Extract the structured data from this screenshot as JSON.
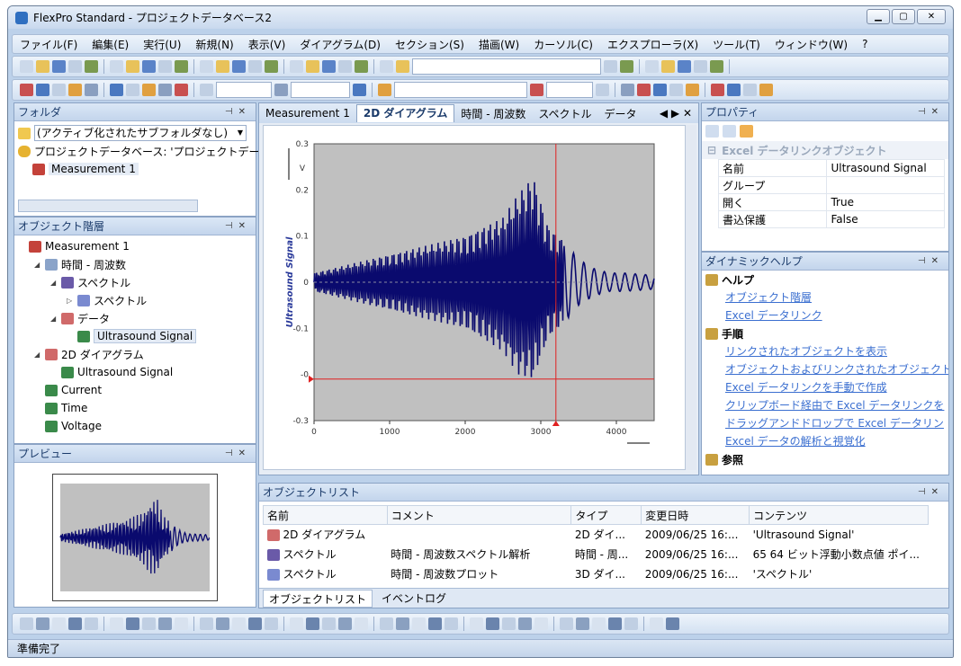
{
  "window": {
    "title": "FlexPro Standard - プロジェクトデータベース2"
  },
  "menu": [
    "ファイル(F)",
    "編集(E)",
    "実行(U)",
    "新規(N)",
    "表示(V)",
    "ダイアグラム(D)",
    "セクション(S)",
    "描画(W)",
    "カーソル(C)",
    "エクスプローラ(X)",
    "ツール(T)",
    "ウィンドウ(W)",
    "?"
  ],
  "folder": {
    "title": "フォルダ",
    "dropdown": "(アクティブ化されたサブフォルダなし)",
    "db": "プロジェクトデータベース: 'プロジェクトデー",
    "item": "Measurement 1"
  },
  "hierarchy": {
    "title": "オブジェクト階層",
    "items": [
      {
        "label": "Measurement 1",
        "indent": 0,
        "icon": "folder-icon"
      },
      {
        "label": "時間 - 周波数",
        "indent": 1,
        "icon": "document-icon",
        "tog": "◢"
      },
      {
        "label": "スペクトル",
        "indent": 2,
        "icon": "spectrum-icon",
        "tog": "◢"
      },
      {
        "label": "スペクトル",
        "indent": 3,
        "icon": "waterfall-icon",
        "tog": "▷"
      },
      {
        "label": "データ",
        "indent": 2,
        "icon": "diagram-icon",
        "tog": "◢"
      },
      {
        "label": "Ultrasound Signal",
        "indent": 3,
        "icon": "excel-link-icon",
        "sel": true
      },
      {
        "label": "2D ダイアグラム",
        "indent": 1,
        "icon": "diagram-icon",
        "tog": "◢"
      },
      {
        "label": "Ultrasound Signal",
        "indent": 2,
        "icon": "excel-link-icon"
      },
      {
        "label": "Current",
        "indent": 1,
        "icon": "excel-link-icon"
      },
      {
        "label": "Time",
        "indent": 1,
        "icon": "excel-link-icon"
      },
      {
        "label": "Voltage",
        "indent": 1,
        "icon": "excel-link-icon"
      }
    ]
  },
  "preview": {
    "title": "プレビュー"
  },
  "tabs": [
    "Measurement 1",
    "2D ダイアグラム",
    "時間 - 周波数",
    "スペクトル",
    "データ"
  ],
  "chart_data": {
    "type": "line",
    "ylabel": "Ultrasound Signal",
    "yunit": "V",
    "xlim": [
      0,
      4500
    ],
    "ylim": [
      -0.3,
      0.3
    ],
    "xticks": [
      "0",
      "1000",
      "2000",
      "3000",
      "4000"
    ],
    "yticks": [
      "0.3",
      "0.2",
      "0.1",
      "0",
      "-0.1",
      "-0",
      "-0.3"
    ],
    "envelope": {
      "x": [
        0,
        500,
        1000,
        1500,
        2000,
        2500,
        2700,
        2900,
        3100,
        3300,
        3500,
        3700,
        3900,
        4100,
        4500
      ],
      "upper": [
        0.02,
        0.04,
        0.06,
        0.08,
        0.1,
        0.14,
        0.19,
        0.23,
        0.12,
        0.09,
        0.05,
        0.03,
        0.02,
        0.02,
        0.015
      ],
      "lower": [
        -0.02,
        -0.04,
        -0.06,
        -0.08,
        -0.1,
        -0.15,
        -0.2,
        -0.21,
        -0.12,
        -0.09,
        -0.05,
        -0.03,
        -0.02,
        -0.02,
        -0.015
      ]
    },
    "cursor_x": 3200,
    "cursor_y": -0.21,
    "color": "#0a0a6e"
  },
  "props": {
    "title": "プロパティ",
    "section": "Excel データリンクオブジェクト",
    "rows": [
      [
        "名前",
        "Ultrasound Signal"
      ],
      [
        "グループ",
        ""
      ],
      [
        "開く",
        "True"
      ],
      [
        "書込保護",
        "False"
      ]
    ]
  },
  "help": {
    "title": "ダイナミックヘルプ",
    "h1": "ヘルプ",
    "links1": [
      "オブジェクト階層",
      "Excel データリンク"
    ],
    "h2": "手順",
    "links2": [
      "リンクされたオブジェクトを表示",
      "オブジェクトおよびリンクされたオブジェクト",
      "Excel データリンクを手動で作成",
      "クリップボード経由で Excel データリンクを",
      "ドラッグアンドドロップで Excel データリン",
      "Excel データの解析と視覚化"
    ],
    "h3": "参照"
  },
  "objlist": {
    "title": "オブジェクトリスト",
    "cols": [
      "名前",
      "コメント",
      "タイプ",
      "変更日時",
      "コンテンツ"
    ],
    "rows": [
      [
        "2D ダイアグラム",
        "",
        "2D ダイ...",
        "2009/06/25 16:...",
        "'Ultrasound Signal'"
      ],
      [
        "スペクトル",
        "時間 - 周波数スペクトル解析",
        "時間 - 周...",
        "2009/06/25 16:...",
        "65 64 ビット浮動小数点値 ポイ..."
      ],
      [
        "スペクトル",
        "時間 - 周波数プロット",
        "3D ダイ...",
        "2009/06/25 16:...",
        "'スペクトル'"
      ]
    ],
    "tabs": [
      "オブジェクトリスト",
      "イベントログ"
    ]
  },
  "status": "準備完了"
}
